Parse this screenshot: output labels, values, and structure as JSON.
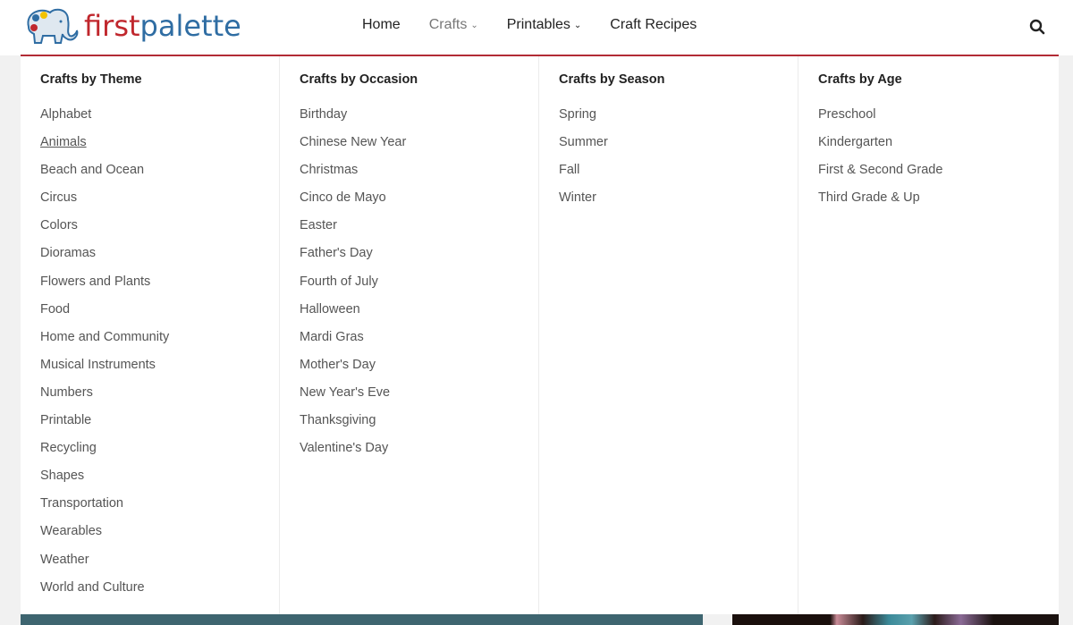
{
  "logo": {
    "part1": "first",
    "part2": "palette"
  },
  "nav": [
    {
      "label": "Home"
    },
    {
      "label": "Crafts",
      "dropdown": true
    },
    {
      "label": "Printables",
      "dropdown": true
    },
    {
      "label": "Craft Recipes"
    }
  ],
  "menu": [
    {
      "heading": "Crafts by Theme",
      "items": [
        "Alphabet",
        "Animals",
        "Beach and Ocean",
        "Circus",
        "Colors",
        "Dioramas",
        "Flowers and Plants",
        "Food",
        "Home and Community",
        "Musical Instruments",
        "Numbers",
        "Printable",
        "Recycling",
        "Shapes",
        "Transportation",
        "Wearables",
        "Weather",
        "World and Culture"
      ]
    },
    {
      "heading": "Crafts by Occasion",
      "items": [
        "Birthday",
        "Chinese New Year",
        "Christmas",
        "Cinco de Mayo",
        "Easter",
        "Father's Day",
        "Fourth of July",
        "Halloween",
        "Mardi Gras",
        "Mother's Day",
        "New Year's Eve",
        "Thanksgiving",
        "Valentine's Day"
      ]
    },
    {
      "heading": "Crafts by Season",
      "items": [
        "Spring",
        "Summer",
        "Fall",
        "Winter"
      ]
    },
    {
      "heading": "Crafts by Age",
      "items": [
        "Preschool",
        "Kindergarten",
        "First & Second Grade",
        "Third Grade & Up"
      ]
    }
  ]
}
